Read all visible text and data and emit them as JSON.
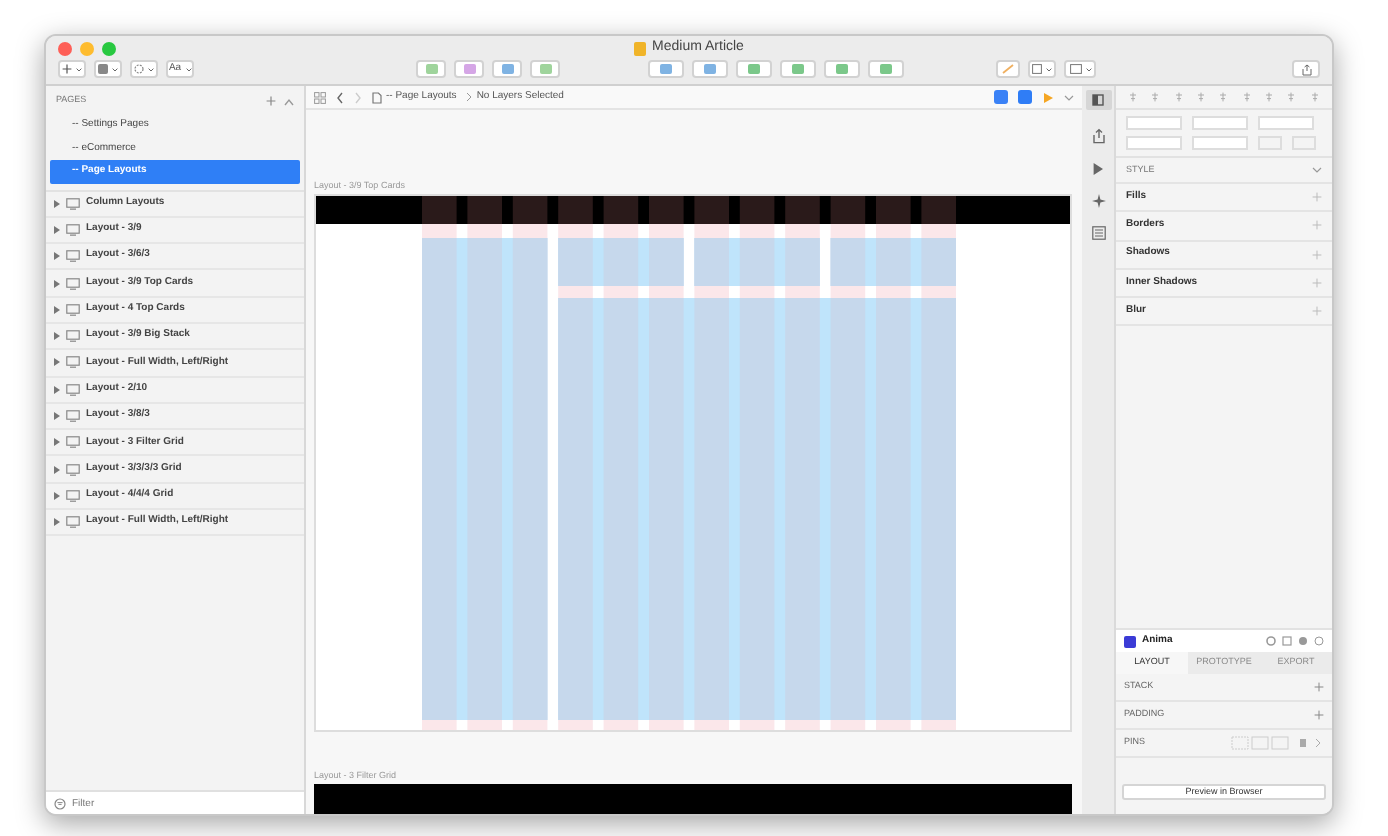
{
  "window": {
    "title": "Medium Article"
  },
  "toolbar": {
    "left_menu": [
      "Aa"
    ]
  },
  "pages": {
    "header": "PAGES",
    "items": [
      {
        "label": "-- Settings Pages",
        "selected": false
      },
      {
        "label": "-- eCommerce",
        "selected": false
      },
      {
        "label": "-- Page Layouts",
        "selected": true
      }
    ]
  },
  "layers": [
    "Column Layouts",
    "Layout - 3/9",
    "Layout - 3/6/3",
    "Layout - 3/9 Top Cards",
    "Layout - 4 Top Cards",
    "Layout - 3/9 Big Stack",
    "Layout - Full Width, Left/Right",
    "Layout - 2/10",
    "Layout - 3/8/3",
    "Layout - 3 Filter Grid",
    "Layout - 3/3/3/3 Grid",
    "Layout - 4/4/4 Grid",
    "Layout - Full Width, Left/Right"
  ],
  "filter": {
    "placeholder": "Filter"
  },
  "breadcrumb": {
    "page": "-- Page Layouts",
    "selection": "No Layers Selected"
  },
  "artboards": [
    {
      "label": "Layout - 3/9 Top Cards"
    },
    {
      "label": "Layout - 3 Filter Grid"
    }
  ],
  "inspector": {
    "style_header": "STYLE",
    "sections": [
      "Fills",
      "Borders",
      "Shadows",
      "Inner Shadows",
      "Blur"
    ]
  },
  "anima": {
    "title": "Anima",
    "tabs": [
      {
        "label": "LAYOUT",
        "selected": true
      },
      {
        "label": "PROTOTYPE",
        "selected": false
      },
      {
        "label": "EXPORT",
        "selected": false
      }
    ],
    "rows": [
      "STACK",
      "PADDING",
      "PINS"
    ],
    "button": "Preview in Browser"
  }
}
